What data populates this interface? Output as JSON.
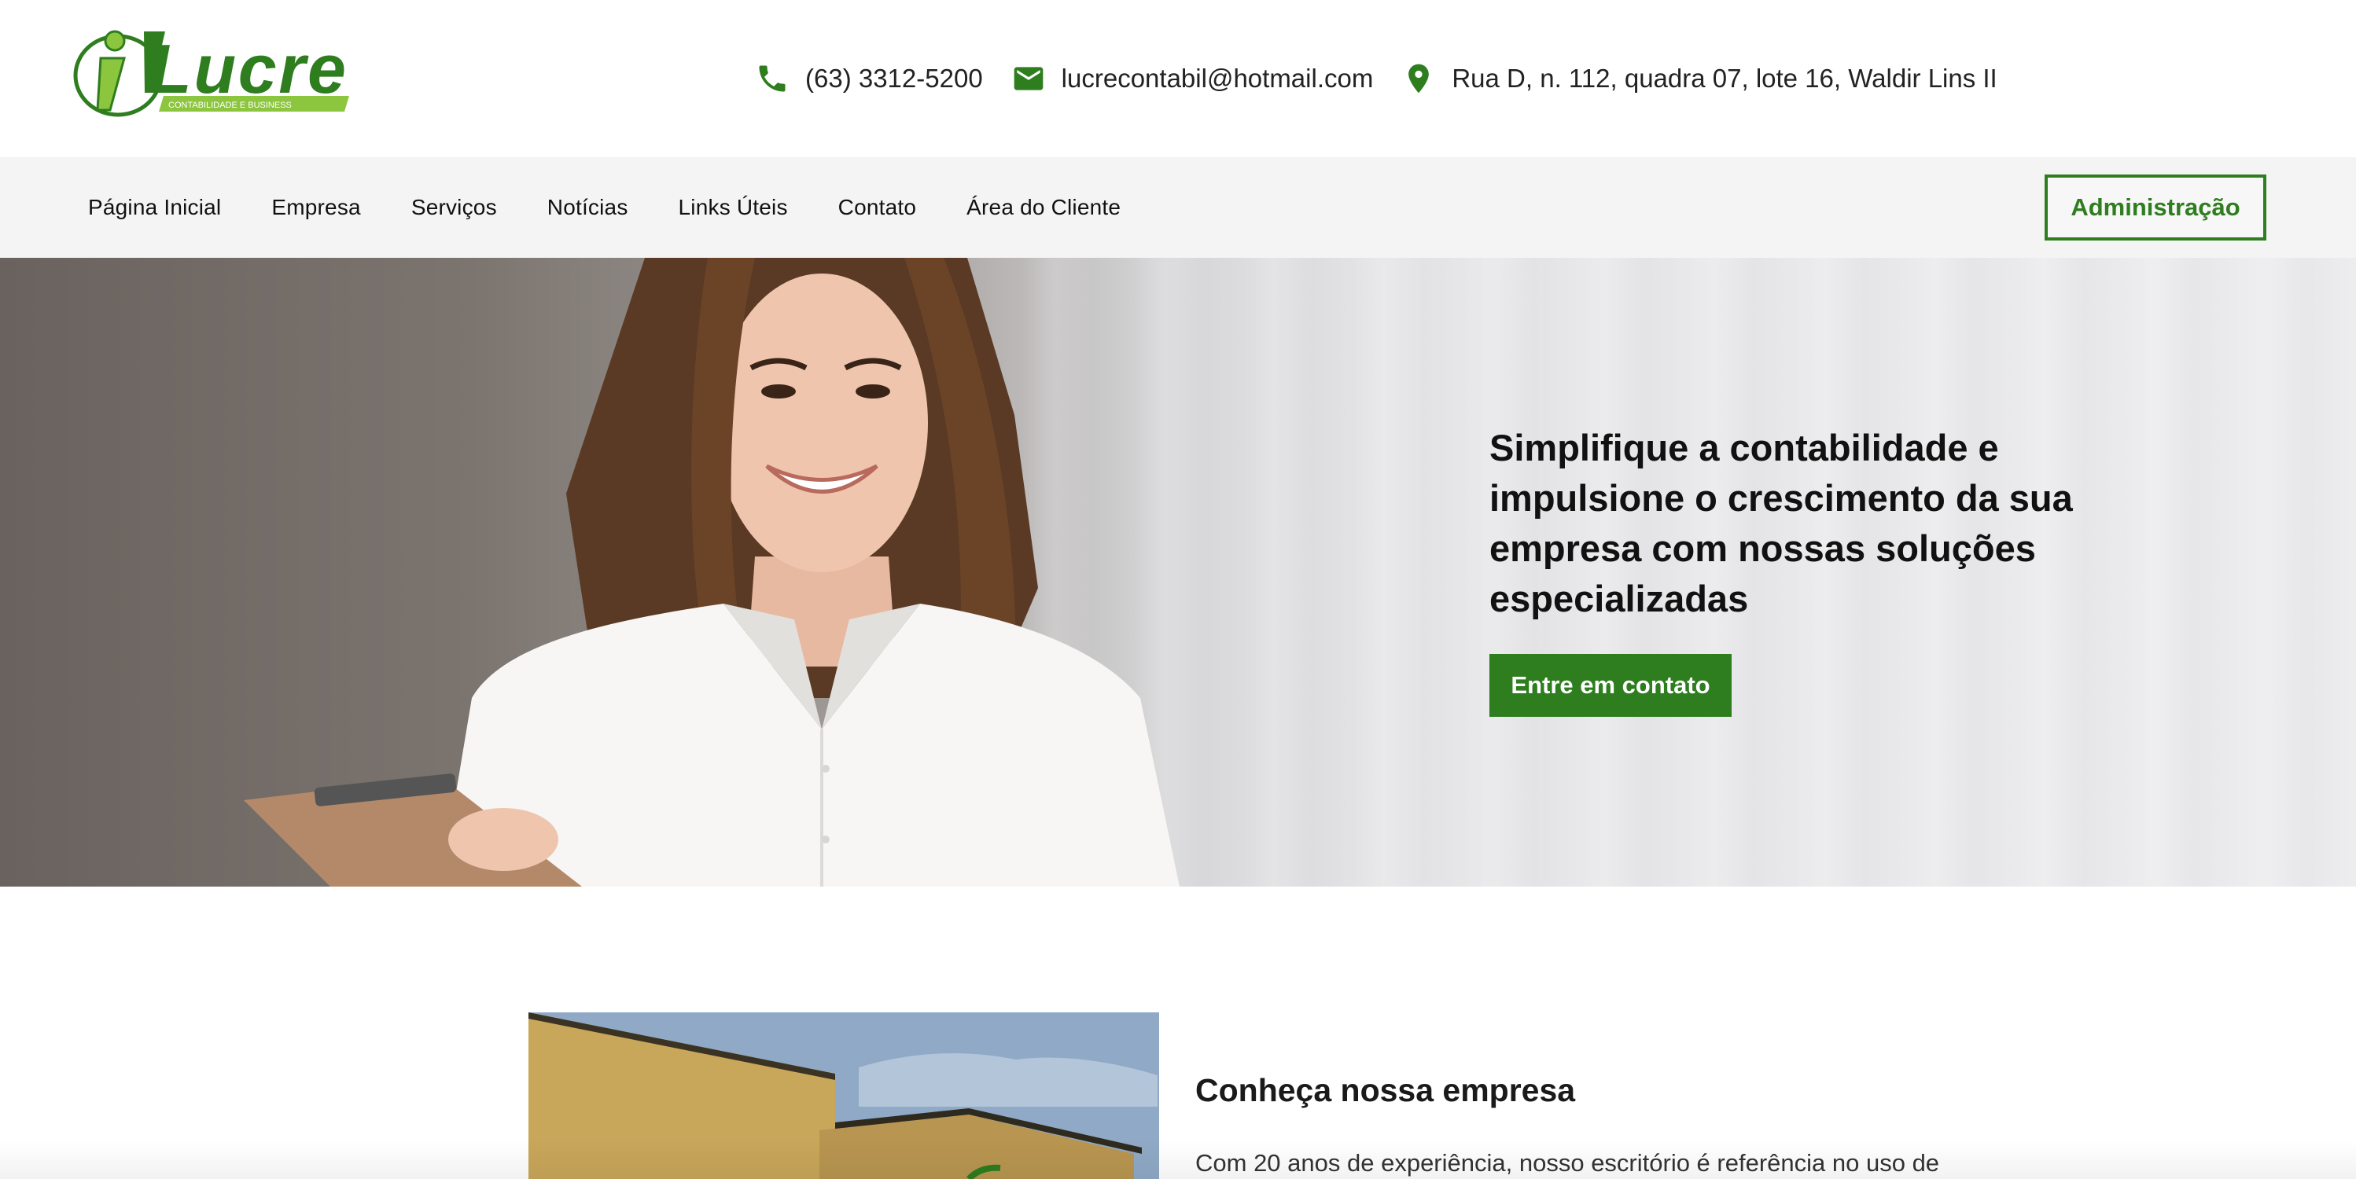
{
  "brand": {
    "name": "Lucre",
    "tagline": "CONTABILIDADE E BUSINESS",
    "accent_color": "#2e7d1e",
    "logo_light_green": "#8cc63f"
  },
  "contact": {
    "phone": "(63) 3312-5200",
    "email": "lucrecontabil@hotmail.com",
    "address": "Rua D, n. 112, quadra 07, lote 16, Waldir Lins II",
    "icons": [
      "phone-icon",
      "mail-icon",
      "location-pin-icon"
    ]
  },
  "nav": {
    "items": [
      {
        "label": "Página Inicial"
      },
      {
        "label": "Empresa"
      },
      {
        "label": "Serviços"
      },
      {
        "label": "Notícias"
      },
      {
        "label": "Links Úteis"
      },
      {
        "label": "Contato"
      },
      {
        "label": "Área do Cliente"
      }
    ],
    "admin_label": "Administração"
  },
  "hero": {
    "title": "Simplifique a contabilidade e impulsione o crescimento da sua empresa com nossas soluções especializadas",
    "cta_label": "Entre em contato"
  },
  "about": {
    "title": "Conheça nossa empresa",
    "text": "Com 20 anos de experiência, nosso escritório é referência no uso de"
  }
}
